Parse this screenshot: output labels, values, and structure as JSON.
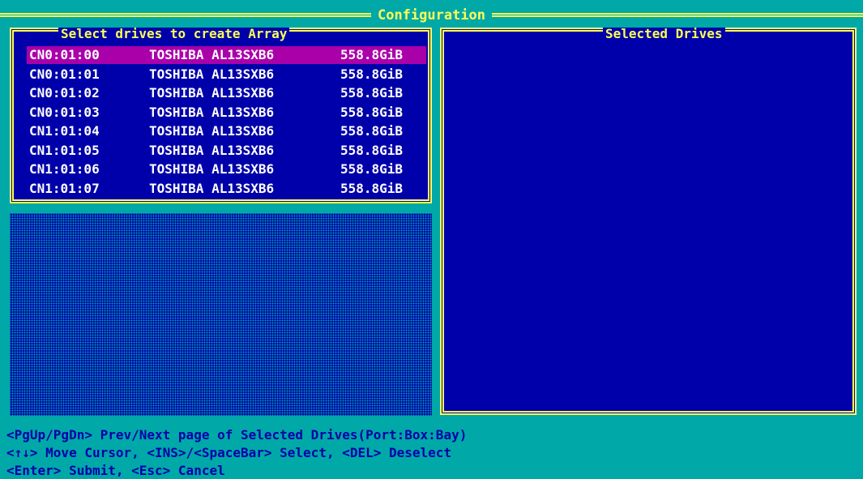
{
  "window": {
    "title": "Configuration"
  },
  "left_panel": {
    "title": "Select drives to create Array",
    "drives": [
      {
        "port": "CN0:01:00",
        "model": "TOSHIBA AL13SXB6",
        "size": "558.8GiB",
        "selected": true
      },
      {
        "port": "CN0:01:01",
        "model": "TOSHIBA AL13SXB6",
        "size": "558.8GiB",
        "selected": false
      },
      {
        "port": "CN0:01:02",
        "model": "TOSHIBA AL13SXB6",
        "size": "558.8GiB",
        "selected": false
      },
      {
        "port": "CN0:01:03",
        "model": "TOSHIBA AL13SXB6",
        "size": "558.8GiB",
        "selected": false
      },
      {
        "port": "CN1:01:04",
        "model": "TOSHIBA AL13SXB6",
        "size": "558.8GiB",
        "selected": false
      },
      {
        "port": "CN1:01:05",
        "model": "TOSHIBA AL13SXB6",
        "size": "558.8GiB",
        "selected": false
      },
      {
        "port": "CN1:01:06",
        "model": "TOSHIBA AL13SXB6",
        "size": "558.8GiB",
        "selected": false
      },
      {
        "port": "CN1:01:07",
        "model": "TOSHIBA AL13SXB6",
        "size": "558.8GiB",
        "selected": false
      }
    ]
  },
  "right_panel": {
    "title": "Selected Drives"
  },
  "status": {
    "line1": "<PgUp/PgDn> Prev/Next page of Selected Drives(Port:Box:Bay)",
    "line2": "<↑↓> Move Cursor, <INS>/<SpaceBar> Select, <DEL> Deselect",
    "line3": "<Enter> Submit, <Esc> Cancel"
  },
  "colors": {
    "background": "#00a8a8",
    "panel": "#0000aa",
    "border": "#ffff55",
    "highlight": "#aa00aa",
    "text": "#ffffff"
  }
}
